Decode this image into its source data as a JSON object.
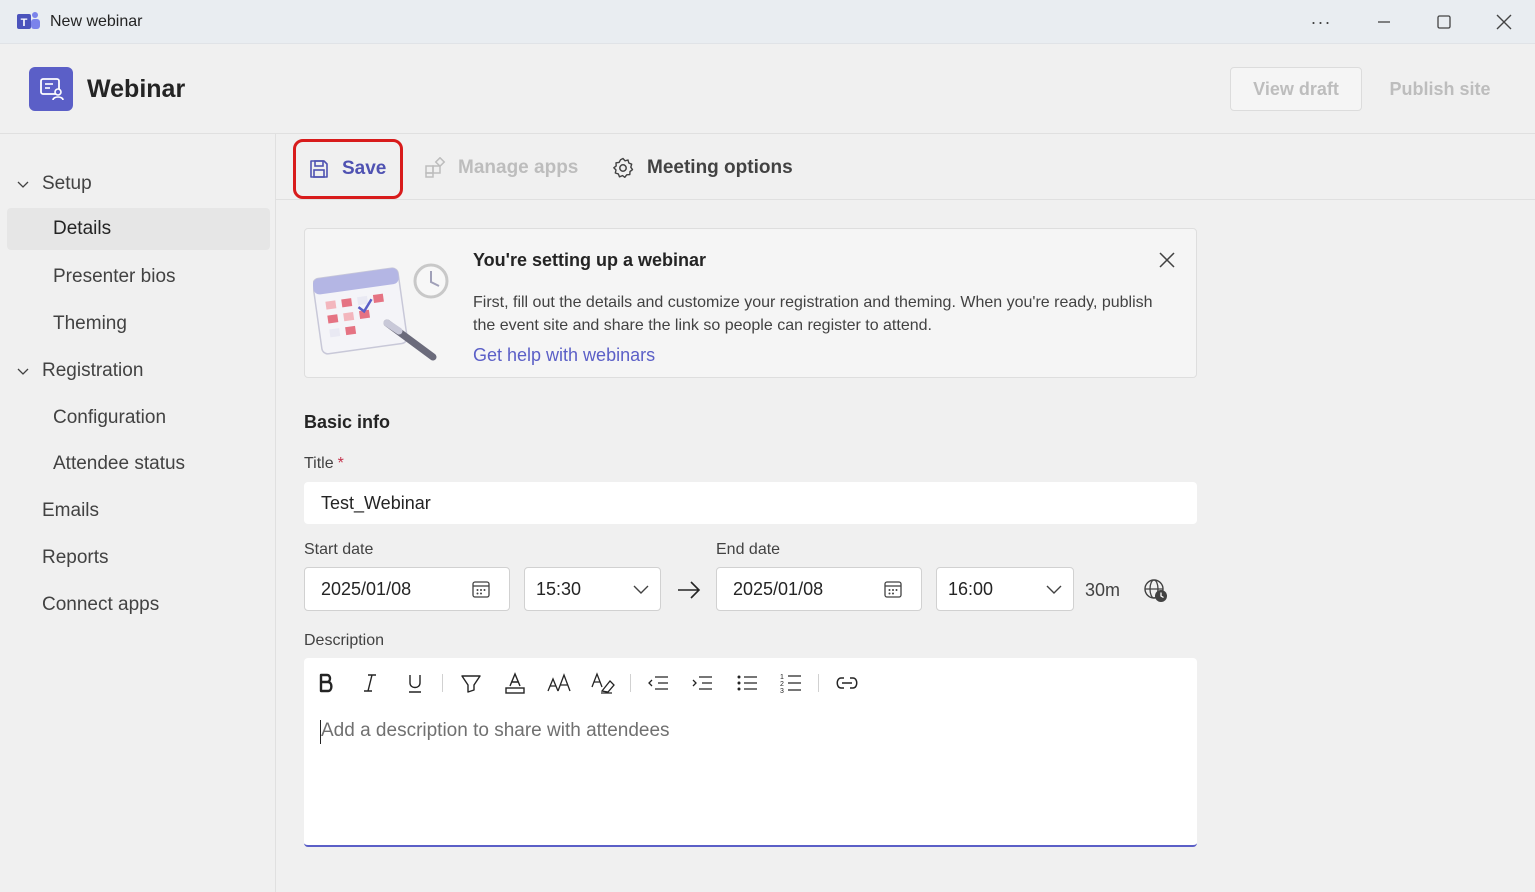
{
  "window": {
    "title": "New webinar",
    "more_label": "···"
  },
  "header": {
    "title": "Webinar",
    "view_draft_label": "View draft",
    "publish_label": "Publish site"
  },
  "sidebar": {
    "groups": [
      {
        "label": "Setup",
        "items": [
          "Details",
          "Presenter bios",
          "Theming"
        ]
      },
      {
        "label": "Registration",
        "items": [
          "Configuration",
          "Attendee status"
        ]
      }
    ],
    "top_items": [
      "Emails",
      "Reports",
      "Connect apps"
    ],
    "active_item": "Details"
  },
  "toolbar": {
    "save_label": "Save",
    "manage_apps_label": "Manage apps",
    "meeting_options_label": "Meeting options"
  },
  "banner": {
    "title": "You're setting up a webinar",
    "body": "First, fill out the details and customize your registration and theming. When you're ready, publish the event site and share the link so people can register to attend.",
    "link": "Get help with webinars"
  },
  "form": {
    "section_title": "Basic info",
    "title_label": "Title",
    "title_required_mark": "*",
    "title_value": "Test_Webinar",
    "start_date_label": "Start date",
    "start_date": "2025/01/08",
    "start_time": "15:30",
    "end_date_label": "End date",
    "end_date": "2025/01/08",
    "end_time": "16:00",
    "duration": "30m",
    "description_label": "Description",
    "description_placeholder": "Add a description to share with attendees"
  },
  "colors": {
    "accent": "#5b5fc7",
    "highlight_border": "#d81b1b",
    "disabled_text": "#bdbdbd"
  },
  "icons": {
    "titlebar": [
      "teams-logo-icon",
      "more-icon",
      "minimize-icon",
      "maximize-icon",
      "close-icon"
    ],
    "toolbar": [
      "save-icon",
      "manage-apps-icon",
      "gear-icon"
    ],
    "rich_text": [
      "bold-icon",
      "italic-icon",
      "underline-icon",
      "highlight-icon",
      "font-color-icon",
      "font-size-icon",
      "clear-format-icon",
      "decrease-indent-icon",
      "increase-indent-icon",
      "bulleted-list-icon",
      "numbered-list-icon",
      "link-icon"
    ]
  }
}
